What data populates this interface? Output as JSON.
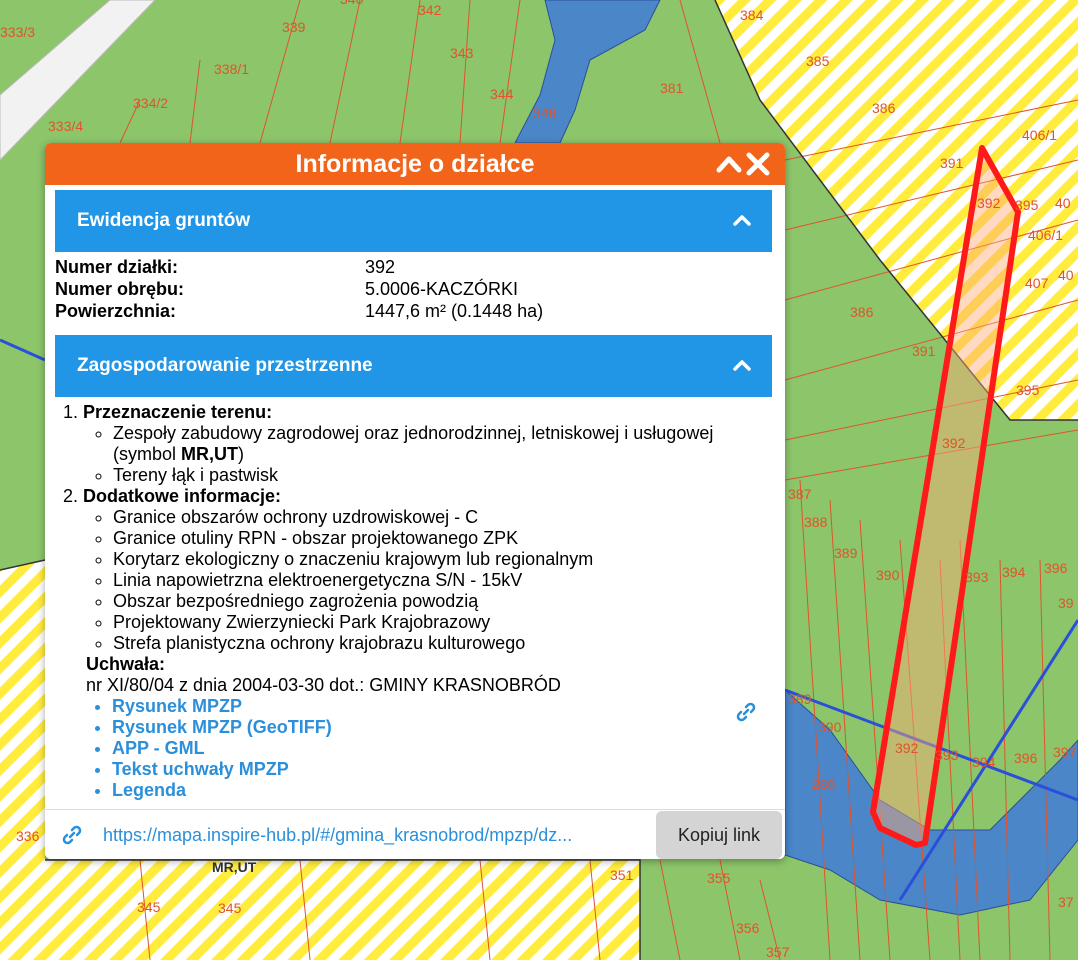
{
  "panel": {
    "title": "Informacje o działce",
    "accent": "#f2641a",
    "section_color": "#2196e6"
  },
  "ewidencja": {
    "title": "Ewidencja gruntów",
    "fields": [
      {
        "label": "Numer działki:",
        "value": "392"
      },
      {
        "label": "Numer obrębu:",
        "value": "5.0006-KACZÓRKI"
      },
      {
        "label": "Powierzchnia:",
        "value": "1447,6 m² (0.1448 ha)"
      }
    ]
  },
  "zagospodarowanie": {
    "title": "Zagospodarowanie przestrzenne",
    "przeznaczenie_title": "Przeznaczenie terenu:",
    "przeznaczenie_item1_prefix": "Zespoły zabudowy zagrodowej oraz jednorodzinnej, letniskowej i usługowej (symbol ",
    "przeznaczenie_item1_symbol": "MR,UT",
    "przeznaczenie_item1_suffix": ")",
    "przeznaczenie_item2": "Tereny łąk i pastwisk",
    "dodatkowe_title": "Dodatkowe informacje:",
    "dodatkowe_items": [
      "Granice obszarów ochrony uzdrowiskowej - C",
      "Granice otuliny RPN - obszar projektowanego ZPK",
      "Korytarz ekologiczny o znaczeniu krajowym lub regionalnym",
      "Linia napowietrzna elektroenergetyczna S/N - 15kV",
      "Obszar bezpośredniego zagrożenia powodzią",
      "Projektowany Zwierzyniecki Park Krajobrazowy",
      "Strefa planistyczna ochrony krajobrazu kulturowego"
    ],
    "uchwala_label": "Uchwała:",
    "uchwala_text": "nr XI/80/04 z dnia 2004-03-30 dot.: GMINY KRASNOBRÓD",
    "links": [
      "Rysunek MPZP",
      "Rysunek MPZP (GeoTIFF)",
      "APP - GML",
      "Tekst uchwały MPZP",
      "Legenda"
    ]
  },
  "footer": {
    "url": "https://mapa.inspire-hub.pl/#/gmina_krasnobrod/mpzp/dz...",
    "copy_label": "Kopiuj link"
  },
  "map": {
    "labels": [
      "333/3",
      "339",
      "340",
      "342",
      "384",
      "338/1",
      "343",
      "385",
      "334/2",
      "344",
      "381",
      "386",
      "348",
      "333/4",
      "406/1",
      "391",
      "392",
      "395",
      "40",
      "406/1",
      "407",
      "40",
      "386",
      "391",
      "395",
      "392",
      "387",
      "388",
      "389",
      "390",
      "393",
      "394",
      "396",
      "39",
      "389",
      "390",
      "392",
      "393",
      "394",
      "396",
      "397",
      "286",
      "MR,UT",
      "345",
      "345",
      "351",
      "355",
      "356",
      "357",
      "37",
      "336"
    ],
    "colors": {
      "green": "#8dc56b",
      "yellow": "#ffec3d",
      "water": "#4a86c8",
      "boundary": "#e0542a",
      "highlight": "#ff1a1a"
    }
  }
}
